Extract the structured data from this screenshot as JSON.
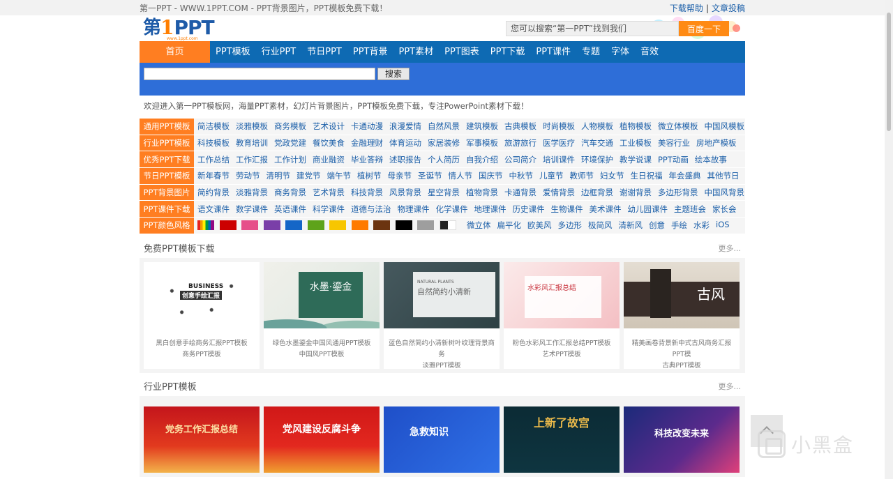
{
  "topbar": {
    "slogan": "第一PPT - WWW.1PPT.COM - PPT背景图片，PPT模板免费下载！",
    "help": "下载帮助",
    "submit": "文章投稿",
    "sep": "|"
  },
  "logo": {
    "di": "第",
    "one": "1",
    "ppt": "PPT",
    "url": "www.1ppt.com"
  },
  "search_top": {
    "placeholder": "您可以搜索“第一PPT”找到我们",
    "button": "百度一下"
  },
  "nav": [
    "首页",
    "PPT模板",
    "行业PPT",
    "节日PPT",
    "PPT背景",
    "PPT素材",
    "PPT图表",
    "PPT下载",
    "PPT课件",
    "专题",
    "字体",
    "音效"
  ],
  "site_search": {
    "button": "搜索"
  },
  "welcome": "欢迎进入第一PPT模板网，海量PPT素材，幻灯片背景图片，PPT模板免费下载，专注PowerPoint素材下载！",
  "categories": [
    {
      "label": "通用PPT模板",
      "links": [
        "简洁模板",
        "淡雅模板",
        "商务模板",
        "艺术设计",
        "卡通动漫",
        "浪漫爱情",
        "自然风景",
        "建筑模板",
        "古典模板",
        "时尚模板",
        "人物模板",
        "植物模板",
        "微立体模板",
        "中国风模板"
      ]
    },
    {
      "label": "行业PPT模板",
      "links": [
        "科技模板",
        "教育培训",
        "党政党建",
        "餐饮美食",
        "金融理财",
        "体育运动",
        "家居装修",
        "军事模板",
        "旅游旅行",
        "医学医疗",
        "汽车交通",
        "工业模板",
        "美容行业",
        "房地产模板"
      ]
    },
    {
      "label": "优秀PPT下载",
      "links": [
        "工作总结",
        "工作汇报",
        "工作计划",
        "商业融资",
        "毕业答辩",
        "述职报告",
        "个人简历",
        "自我介绍",
        "公司简介",
        "培训课件",
        "环境保护",
        "教学说课",
        "PPT动画",
        "绘本故事"
      ]
    },
    {
      "label": "节日PPT模板",
      "links": [
        "新年春节",
        "劳动节",
        "清明节",
        "建党节",
        "端午节",
        "植树节",
        "母亲节",
        "圣诞节",
        "情人节",
        "国庆节",
        "中秋节",
        "儿童节",
        "教师节",
        "妇女节",
        "生日祝福",
        "年会盛典",
        "其他节日"
      ]
    },
    {
      "label": "PPT背景图片",
      "links": [
        "简约背景",
        "淡雅背景",
        "商务背景",
        "艺术背景",
        "科技背景",
        "风景背景",
        "星空背景",
        "植物背景",
        "卡通背景",
        "爱情背景",
        "边框背景",
        "谢谢背景",
        "多边形背景",
        "中国风背景"
      ]
    },
    {
      "label": "PPT课件下载",
      "links": [
        "语文课件",
        "数学课件",
        "英语课件",
        "科学课件",
        "道德与法治",
        "物理课件",
        "化学课件",
        "地理课件",
        "历史课件",
        "生物课件",
        "美术课件",
        "幼儿园课件",
        "主题班会",
        "家长会"
      ]
    }
  ],
  "color_row": {
    "label": "PPT颜色风格",
    "colors": [
      "#cc0000",
      "#e6508a",
      "#7a3fa8",
      "#1566c7",
      "#5ea31a",
      "#f7c600",
      "#ff7a00",
      "#6b3410",
      "#000000",
      "#9e9e9e"
    ],
    "styles": [
      "微立体",
      "扁平化",
      "欧美风",
      "多边形",
      "极简风",
      "清新风",
      "创意",
      "手绘",
      "水彩",
      "iOS"
    ]
  },
  "section_free": {
    "title": "免费PPT模板下载",
    "more": "更多...",
    "items": [
      {
        "line1": "黑白创意手绘商务汇报PPT模板",
        "line2": "商务PPT模板",
        "thumb_text": [
          "BUSINESS",
          "创意手绘汇报"
        ]
      },
      {
        "line1": "绿色水墨鎏金中国风通用PPT模板",
        "line2": "中国风PPT模板",
        "thumb_text": [
          "水墨·鎏金"
        ]
      },
      {
        "line1": "蓝色自然简约小清新树叶纹理背景商务",
        "line2": "淡雅PPT模板",
        "thumb_text": [
          "NATURAL PLANTS",
          "自然简约小清新"
        ]
      },
      {
        "line1": "粉色水彩风工作汇报总结PPT模板",
        "line2": "艺术PPT模板",
        "thumb_text": [
          "水彩风汇报总结"
        ]
      },
      {
        "line1": "精美画卷背景新中式古风商务汇报PPT模",
        "line2": "古典PPT模板",
        "thumb_text": [
          "古风"
        ]
      }
    ]
  },
  "section_industry": {
    "title": "行业PPT模板",
    "more": "更多...",
    "items": [
      {
        "thumb_text": "党务工作汇报总结"
      },
      {
        "thumb_text": "党风建设反腐斗争"
      },
      {
        "thumb_text": "急救知识"
      },
      {
        "thumb_text": "上新了故宫"
      },
      {
        "thumb_text": "科技改变未来"
      }
    ]
  },
  "watermark": {
    "text": "小黑盒"
  }
}
